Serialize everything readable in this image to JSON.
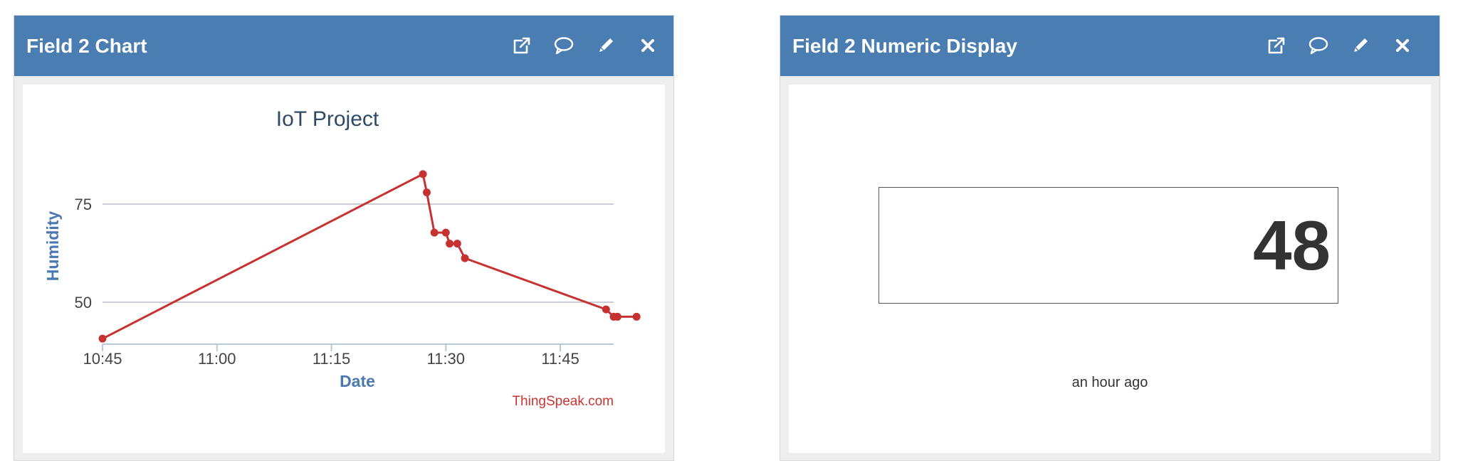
{
  "widgets": [
    {
      "title": "Field 2 Chart",
      "icons": [
        "external-link-icon",
        "comment-icon",
        "pencil-icon",
        "close-icon"
      ]
    },
    {
      "title": "Field 2 Numeric Display",
      "icons": [
        "external-link-icon",
        "comment-icon",
        "pencil-icon",
        "close-icon"
      ],
      "value": "48",
      "updated": "an hour ago"
    }
  ],
  "colors": {
    "header_bg": "#4a7eb3",
    "series_line": "#c63230",
    "credit": "#cc3333"
  },
  "chart_data": {
    "type": "line",
    "title": "IoT Project",
    "xlabel": "Date",
    "ylabel": "Humidity",
    "credit": "ThingSpeak.com",
    "x_tick_labels": [
      "10:45",
      "11:00",
      "11:15",
      "11:30",
      "11:45"
    ],
    "y_tick_labels": [
      "50",
      "75"
    ],
    "y_ticks": [
      50,
      75
    ],
    "ylim": [
      40.5,
      93
    ],
    "xlim": [
      "10:45",
      "11:52"
    ],
    "grid": true,
    "legend": false,
    "series": [
      {
        "x": [
          "10:45",
          "11:27",
          "11:27:30",
          "11:28:30",
          "11:30",
          "11:30:30",
          "11:31:30",
          "11:32:30",
          "11:51",
          "11:52",
          "11:52:30",
          "11:55"
        ],
        "values": [
          42,
          87,
          82,
          71,
          71,
          68,
          68,
          64,
          50,
          48,
          48,
          48
        ]
      }
    ]
  }
}
